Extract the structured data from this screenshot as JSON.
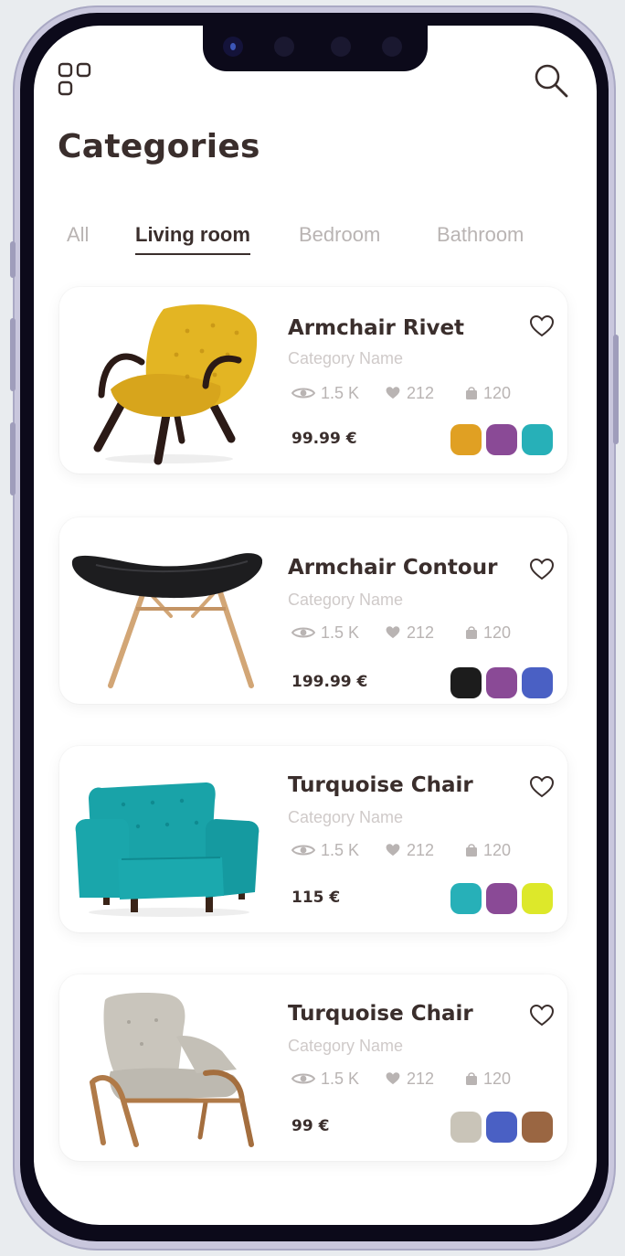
{
  "header": {
    "menu_icon": "grid-menu-icon",
    "search_icon": "search-icon",
    "title": "Categories"
  },
  "tabs": [
    {
      "label": "All",
      "active": false
    },
    {
      "label": "Living room",
      "active": true
    },
    {
      "label": "Bedroom",
      "active": false
    },
    {
      "label": "Bathroom",
      "active": false
    }
  ],
  "products": [
    {
      "name": "Armchair Rivet",
      "category": "Category Name",
      "views": "1.5 K",
      "likes": "212",
      "sales": "120",
      "price": "99.99 €",
      "colors": [
        "#e0a023",
        "#8a4a96",
        "#27b0b8"
      ]
    },
    {
      "name": "Armchair Contour",
      "category": "Category Name",
      "views": "1.5 K",
      "likes": "212",
      "sales": "120",
      "price": "199.99 €",
      "colors": [
        "#1c1c1c",
        "#8a4a96",
        "#4a60c4"
      ]
    },
    {
      "name": "Turquoise Chair",
      "category": "Category Name",
      "views": "1.5 K",
      "likes": "212",
      "sales": "120",
      "price": "115 €",
      "colors": [
        "#27b0b8",
        "#8a4a96",
        "#dde82a"
      ]
    },
    {
      "name": "Turquoise Chair",
      "category": "Category Name",
      "views": "1.5 K",
      "likes": "212",
      "sales": "120",
      "price": "99 €",
      "colors": [
        "#c9c4b8",
        "#4a60c4",
        "#9a6642"
      ]
    }
  ],
  "colors": {
    "text_dark": "#3a2e2c",
    "text_muted": "#b9b4b3",
    "card_bg": "#ffffff"
  }
}
